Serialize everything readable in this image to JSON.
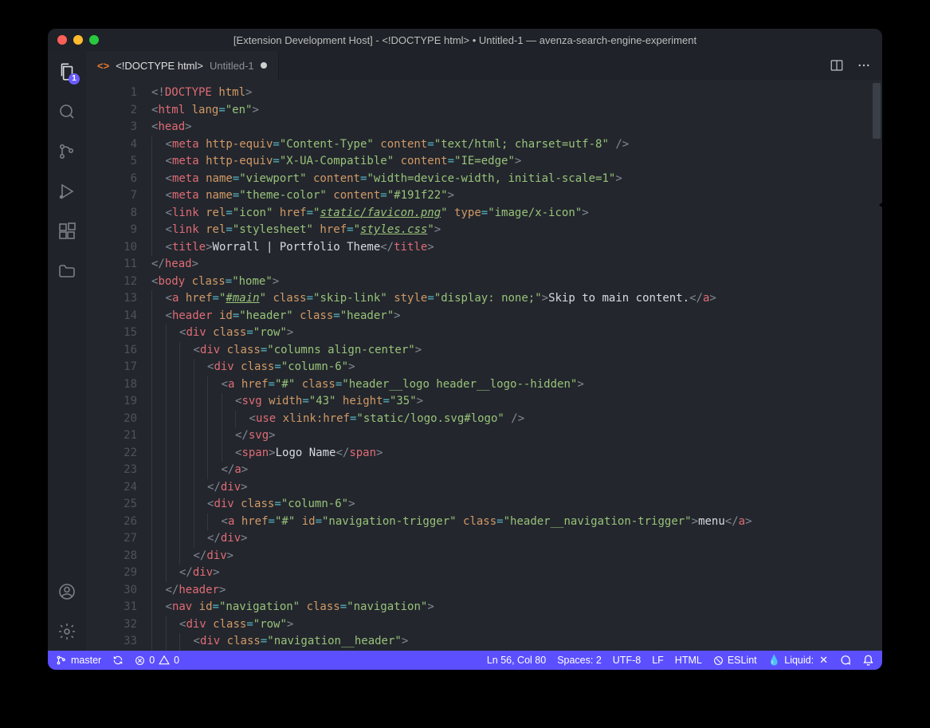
{
  "window": {
    "title": "[Extension Development Host] - <!DOCTYPE html> • Untitled-1 — avenza-search-engine-experiment"
  },
  "activity": {
    "explorer_badge": "1"
  },
  "tab": {
    "lang_icon": "<>",
    "filename": "<!DOCTYPE html>",
    "subname": "Untitled-1"
  },
  "code": {
    "lines": [
      [
        [
          "pun",
          "<!"
        ],
        [
          "tagn",
          "DOCTYPE"
        ],
        [
          "txt",
          " "
        ],
        [
          "attr",
          "html"
        ],
        [
          "pun",
          ">"
        ]
      ],
      [
        [
          "pun",
          "<"
        ],
        [
          "tagn",
          "html"
        ],
        [
          "txt",
          " "
        ],
        [
          "attr",
          "lang"
        ],
        [
          "op",
          "="
        ],
        [
          "str",
          "\"en\""
        ],
        [
          "pun",
          ">"
        ]
      ],
      [
        [
          "pun",
          "<"
        ],
        [
          "tagn",
          "head"
        ],
        [
          "pun",
          ">"
        ]
      ],
      [
        [
          "pun",
          "<"
        ],
        [
          "tagn",
          "meta"
        ],
        [
          "txt",
          " "
        ],
        [
          "attr",
          "http-equiv"
        ],
        [
          "op",
          "="
        ],
        [
          "str",
          "\"Content-Type\""
        ],
        [
          "txt",
          " "
        ],
        [
          "attr",
          "content"
        ],
        [
          "op",
          "="
        ],
        [
          "str",
          "\"text/html; charset=utf-8\""
        ],
        [
          "txt",
          " "
        ],
        [
          "pun",
          "/>"
        ]
      ],
      [
        [
          "pun",
          "<"
        ],
        [
          "tagn",
          "meta"
        ],
        [
          "txt",
          " "
        ],
        [
          "attr",
          "http-equiv"
        ],
        [
          "op",
          "="
        ],
        [
          "str",
          "\"X-UA-Compatible\""
        ],
        [
          "txt",
          " "
        ],
        [
          "attr",
          "content"
        ],
        [
          "op",
          "="
        ],
        [
          "str",
          "\"IE=edge\""
        ],
        [
          "pun",
          ">"
        ]
      ],
      [
        [
          "pun",
          "<"
        ],
        [
          "tagn",
          "meta"
        ],
        [
          "txt",
          " "
        ],
        [
          "attr",
          "name"
        ],
        [
          "op",
          "="
        ],
        [
          "str",
          "\"viewport\""
        ],
        [
          "txt",
          " "
        ],
        [
          "attr",
          "content"
        ],
        [
          "op",
          "="
        ],
        [
          "str",
          "\"width=device-width, initial-scale=1\""
        ],
        [
          "pun",
          ">"
        ]
      ],
      [
        [
          "pun",
          "<"
        ],
        [
          "tagn",
          "meta"
        ],
        [
          "txt",
          " "
        ],
        [
          "attr",
          "name"
        ],
        [
          "op",
          "="
        ],
        [
          "str",
          "\"theme-color\""
        ],
        [
          "txt",
          " "
        ],
        [
          "attr",
          "content"
        ],
        [
          "op",
          "="
        ],
        [
          "str",
          "\"#191f22\""
        ],
        [
          "pun",
          ">"
        ]
      ],
      [
        [
          "pun",
          "<"
        ],
        [
          "tagn",
          "link"
        ],
        [
          "txt",
          " "
        ],
        [
          "attr",
          "rel"
        ],
        [
          "op",
          "="
        ],
        [
          "str",
          "\"icon\""
        ],
        [
          "txt",
          " "
        ],
        [
          "attr",
          "href"
        ],
        [
          "op",
          "="
        ],
        [
          "str",
          "\""
        ],
        [
          "lnk",
          "static/favicon.png"
        ],
        [
          "str",
          "\""
        ],
        [
          "txt",
          " "
        ],
        [
          "attr",
          "type"
        ],
        [
          "op",
          "="
        ],
        [
          "str",
          "\"image/x-icon\""
        ],
        [
          "pun",
          ">"
        ]
      ],
      [
        [
          "pun",
          "<"
        ],
        [
          "tagn",
          "link"
        ],
        [
          "txt",
          " "
        ],
        [
          "attr",
          "rel"
        ],
        [
          "op",
          "="
        ],
        [
          "str",
          "\"stylesheet\""
        ],
        [
          "txt",
          " "
        ],
        [
          "attr",
          "href"
        ],
        [
          "op",
          "="
        ],
        [
          "str",
          "\""
        ],
        [
          "lnk",
          "styles.css"
        ],
        [
          "str",
          "\""
        ],
        [
          "pun",
          ">"
        ]
      ],
      [
        [
          "pun",
          "<"
        ],
        [
          "tagn",
          "title"
        ],
        [
          "pun",
          ">"
        ],
        [
          "txt",
          "Worrall | Portfolio Theme"
        ],
        [
          "pun",
          "</"
        ],
        [
          "tagn",
          "title"
        ],
        [
          "pun",
          ">"
        ]
      ],
      [
        [
          "pun",
          "</"
        ],
        [
          "tagn",
          "head"
        ],
        [
          "pun",
          ">"
        ]
      ],
      [
        [
          "pun",
          "<"
        ],
        [
          "tagn",
          "body"
        ],
        [
          "txt",
          " "
        ],
        [
          "attr",
          "class"
        ],
        [
          "op",
          "="
        ],
        [
          "str",
          "\"home\""
        ],
        [
          "pun",
          ">"
        ]
      ],
      [
        [
          "pun",
          "<"
        ],
        [
          "tagn",
          "a"
        ],
        [
          "txt",
          " "
        ],
        [
          "attr",
          "href"
        ],
        [
          "op",
          "="
        ],
        [
          "str",
          "\""
        ],
        [
          "lnk",
          "#main"
        ],
        [
          "str",
          "\""
        ],
        [
          "txt",
          " "
        ],
        [
          "attr",
          "class"
        ],
        [
          "op",
          "="
        ],
        [
          "str",
          "\"skip-link\""
        ],
        [
          "txt",
          " "
        ],
        [
          "attr",
          "style"
        ],
        [
          "op",
          "="
        ],
        [
          "str",
          "\"display: none;\""
        ],
        [
          "pun",
          ">"
        ],
        [
          "txt",
          "Skip to main content."
        ],
        [
          "pun",
          "</"
        ],
        [
          "tagn",
          "a"
        ],
        [
          "pun",
          ">"
        ]
      ],
      [
        [
          "pun",
          "<"
        ],
        [
          "tagn",
          "header"
        ],
        [
          "txt",
          " "
        ],
        [
          "attr",
          "id"
        ],
        [
          "op",
          "="
        ],
        [
          "str",
          "\"header\""
        ],
        [
          "txt",
          " "
        ],
        [
          "attr",
          "class"
        ],
        [
          "op",
          "="
        ],
        [
          "str",
          "\"header\""
        ],
        [
          "pun",
          ">"
        ]
      ],
      [
        [
          "pun",
          "<"
        ],
        [
          "tagn",
          "div"
        ],
        [
          "txt",
          " "
        ],
        [
          "attr",
          "class"
        ],
        [
          "op",
          "="
        ],
        [
          "str",
          "\"row\""
        ],
        [
          "pun",
          ">"
        ]
      ],
      [
        [
          "pun",
          "<"
        ],
        [
          "tagn",
          "div"
        ],
        [
          "txt",
          " "
        ],
        [
          "attr",
          "class"
        ],
        [
          "op",
          "="
        ],
        [
          "str",
          "\"columns align-center\""
        ],
        [
          "pun",
          ">"
        ]
      ],
      [
        [
          "pun",
          "<"
        ],
        [
          "tagn",
          "div"
        ],
        [
          "txt",
          " "
        ],
        [
          "attr",
          "class"
        ],
        [
          "op",
          "="
        ],
        [
          "str",
          "\"column-6\""
        ],
        [
          "pun",
          ">"
        ]
      ],
      [
        [
          "pun",
          "<"
        ],
        [
          "tagn",
          "a"
        ],
        [
          "txt",
          " "
        ],
        [
          "attr",
          "href"
        ],
        [
          "op",
          "="
        ],
        [
          "str",
          "\"#\""
        ],
        [
          "txt",
          " "
        ],
        [
          "attr",
          "class"
        ],
        [
          "op",
          "="
        ],
        [
          "str",
          "\"header__logo header__logo--hidden\""
        ],
        [
          "pun",
          ">"
        ]
      ],
      [
        [
          "pun",
          "<"
        ],
        [
          "tagn",
          "svg"
        ],
        [
          "txt",
          " "
        ],
        [
          "attr",
          "width"
        ],
        [
          "op",
          "="
        ],
        [
          "str",
          "\"43\""
        ],
        [
          "txt",
          " "
        ],
        [
          "attr",
          "height"
        ],
        [
          "op",
          "="
        ],
        [
          "str",
          "\"35\""
        ],
        [
          "pun",
          ">"
        ]
      ],
      [
        [
          "pun",
          "<"
        ],
        [
          "tagn",
          "use"
        ],
        [
          "txt",
          " "
        ],
        [
          "attr",
          "xlink:href"
        ],
        [
          "op",
          "="
        ],
        [
          "str",
          "\"static/logo.svg#logo\""
        ],
        [
          "txt",
          " "
        ],
        [
          "pun",
          "/>"
        ]
      ],
      [
        [
          "pun",
          "</"
        ],
        [
          "tagn",
          "svg"
        ],
        [
          "pun",
          ">"
        ]
      ],
      [
        [
          "pun",
          "<"
        ],
        [
          "tagn",
          "span"
        ],
        [
          "pun",
          ">"
        ],
        [
          "txt",
          "Logo Name"
        ],
        [
          "pun",
          "</"
        ],
        [
          "tagn",
          "span"
        ],
        [
          "pun",
          ">"
        ]
      ],
      [
        [
          "pun",
          "</"
        ],
        [
          "tagn",
          "a"
        ],
        [
          "pun",
          ">"
        ]
      ],
      [
        [
          "pun",
          "</"
        ],
        [
          "tagn",
          "div"
        ],
        [
          "pun",
          ">"
        ]
      ],
      [
        [
          "pun",
          "<"
        ],
        [
          "tagn",
          "div"
        ],
        [
          "txt",
          " "
        ],
        [
          "attr",
          "class"
        ],
        [
          "op",
          "="
        ],
        [
          "str",
          "\"column-6\""
        ],
        [
          "pun",
          ">"
        ]
      ],
      [
        [
          "pun",
          "<"
        ],
        [
          "tagn",
          "a"
        ],
        [
          "txt",
          " "
        ],
        [
          "attr",
          "href"
        ],
        [
          "op",
          "="
        ],
        [
          "str",
          "\"#\""
        ],
        [
          "txt",
          " "
        ],
        [
          "attr",
          "id"
        ],
        [
          "op",
          "="
        ],
        [
          "str",
          "\"navigation-trigger\""
        ],
        [
          "txt",
          " "
        ],
        [
          "attr",
          "class"
        ],
        [
          "op",
          "="
        ],
        [
          "str",
          "\"header__navigation-trigger\""
        ],
        [
          "pun",
          ">"
        ],
        [
          "txt",
          "menu"
        ],
        [
          "pun",
          "</"
        ],
        [
          "tagn",
          "a"
        ],
        [
          "pun",
          ">"
        ]
      ],
      [
        [
          "pun",
          "</"
        ],
        [
          "tagn",
          "div"
        ],
        [
          "pun",
          ">"
        ]
      ],
      [
        [
          "pun",
          "</"
        ],
        [
          "tagn",
          "div"
        ],
        [
          "pun",
          ">"
        ]
      ],
      [
        [
          "pun",
          "</"
        ],
        [
          "tagn",
          "div"
        ],
        [
          "pun",
          ">"
        ]
      ],
      [
        [
          "pun",
          "</"
        ],
        [
          "tagn",
          "header"
        ],
        [
          "pun",
          ">"
        ]
      ],
      [
        [
          "pun",
          "<"
        ],
        [
          "tagn",
          "nav"
        ],
        [
          "txt",
          " "
        ],
        [
          "attr",
          "id"
        ],
        [
          "op",
          "="
        ],
        [
          "str",
          "\"navigation\""
        ],
        [
          "txt",
          " "
        ],
        [
          "attr",
          "class"
        ],
        [
          "op",
          "="
        ],
        [
          "str",
          "\"navigation\""
        ],
        [
          "pun",
          ">"
        ]
      ],
      [
        [
          "pun",
          "<"
        ],
        [
          "tagn",
          "div"
        ],
        [
          "txt",
          " "
        ],
        [
          "attr",
          "class"
        ],
        [
          "op",
          "="
        ],
        [
          "str",
          "\"row\""
        ],
        [
          "pun",
          ">"
        ]
      ],
      [
        [
          "pun",
          "<"
        ],
        [
          "tagn",
          "div"
        ],
        [
          "txt",
          " "
        ],
        [
          "attr",
          "class"
        ],
        [
          "op",
          "="
        ],
        [
          "str",
          "\"navigation__header\""
        ],
        [
          "pun",
          ">"
        ]
      ]
    ],
    "indents": [
      0,
      0,
      0,
      1,
      1,
      1,
      1,
      1,
      1,
      1,
      0,
      0,
      1,
      1,
      2,
      3,
      4,
      5,
      6,
      7,
      6,
      6,
      5,
      4,
      4,
      5,
      4,
      3,
      2,
      1,
      1,
      2,
      3
    ]
  },
  "statusbar": {
    "branch": "master",
    "errors": "0",
    "warnings": "0",
    "cursor": "Ln 56, Col 80",
    "spaces": "Spaces: 2",
    "encoding": "UTF-8",
    "eol": "LF",
    "language": "HTML",
    "eslint": "ESLint",
    "liquid": "Liquid:"
  }
}
